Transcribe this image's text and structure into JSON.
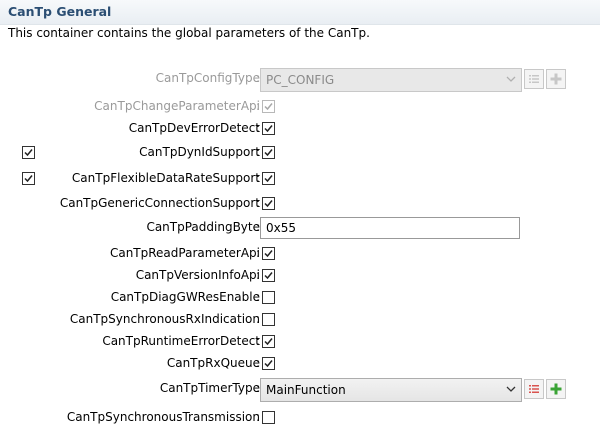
{
  "header": {
    "title": "CanTp General",
    "description": "This container contains the global parameters of the CanTp."
  },
  "colon": ":",
  "params": {
    "config_type": {
      "label": "CanTpConfigType",
      "value": "PC_CONFIG",
      "enabled": false
    },
    "change_param_api": {
      "label": "CanTpChangeParameterApi",
      "checked": true,
      "enabled": false
    },
    "dev_error_detect": {
      "label": "CanTpDevErrorDetect",
      "checked": true
    },
    "dyn_id_support": {
      "label": "CanTpDynIdSupport",
      "checked": true,
      "side_checked": true
    },
    "flexible_data_rate": {
      "label": "CanTpFlexibleDataRateSupport",
      "checked": true,
      "side_checked": true
    },
    "generic_connection": {
      "label": "CanTpGenericConnectionSupport",
      "checked": true
    },
    "padding_byte": {
      "label": "CanTpPaddingByte",
      "value": "0x55"
    },
    "read_param_api": {
      "label": "CanTpReadParameterApi",
      "checked": true
    },
    "version_info_api": {
      "label": "CanTpVersionInfoApi",
      "checked": true
    },
    "diag_gw_res_enable": {
      "label": "CanTpDiagGWResEnable",
      "checked": false
    },
    "sync_rx_indication": {
      "label": "CanTpSynchronousRxIndication",
      "checked": false
    },
    "runtime_error_detect": {
      "label": "CanTpRuntimeErrorDetect",
      "checked": true
    },
    "rx_queue": {
      "label": "CanTpRxQueue",
      "checked": true
    },
    "timer_type": {
      "label": "CanTpTimerType",
      "value": "MainFunction",
      "enabled": true
    },
    "sync_transmission": {
      "label": "CanTpSynchronousTransmission",
      "checked": false
    }
  },
  "icons": {
    "dropdown": "chevron-down-icon",
    "list": "list-icon",
    "add": "plus-icon"
  },
  "colors": {
    "title": "#2b4e73",
    "add_icon": "#3aa335",
    "list_icon": "#d9534f"
  }
}
